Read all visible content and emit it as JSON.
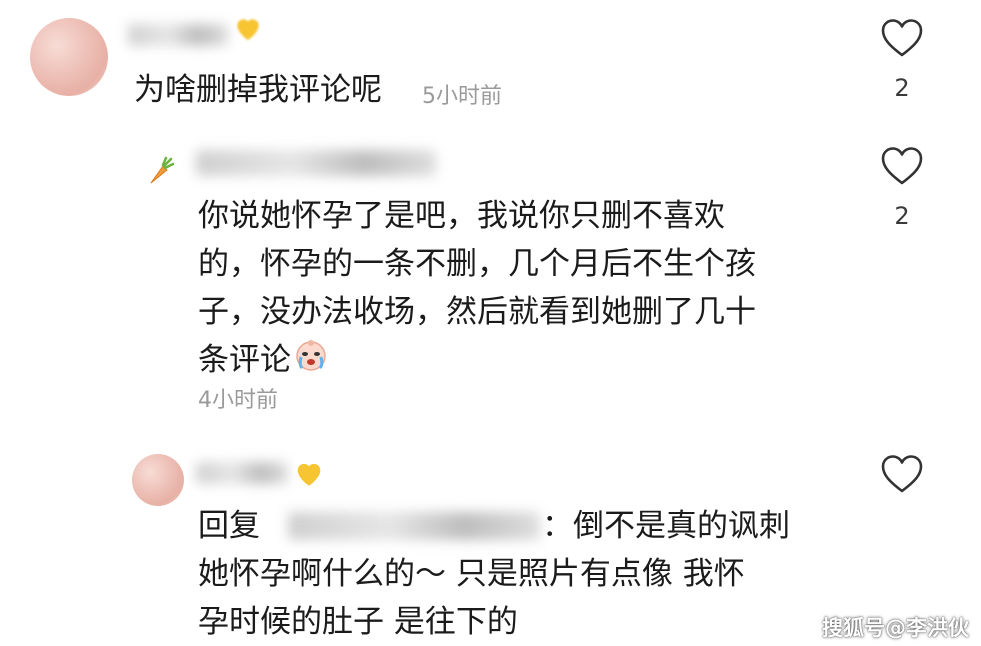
{
  "comments": [
    {
      "text": "为啥删掉我评论呢",
      "time": "5小时前",
      "likes": "2"
    },
    {
      "lines": [
        "你说她怀孕了是吧，我说你只删不喜欢",
        "的，怀孕的一条不删，几个月后不生个孩",
        "子，没办法收场，然后就看到她删了几十",
        "条评论"
      ],
      "time": "4小时前",
      "likes": "2"
    },
    {
      "lines": [
        "回复",
        "：倒不是真的讽刺",
        "她怀孕啊什么的～ 只是照片有点像 我怀",
        "孕时候的肚子 是往下的"
      ]
    }
  ],
  "watermark": "搜狐号@李洪伙",
  "colors": {
    "heart": "#333333",
    "time": "#9a9a9a",
    "text": "#1b1b1b"
  },
  "icons": [
    "heart-icon",
    "carrot-icon",
    "yellow-heart-icon",
    "crying-emoji-icon"
  ]
}
